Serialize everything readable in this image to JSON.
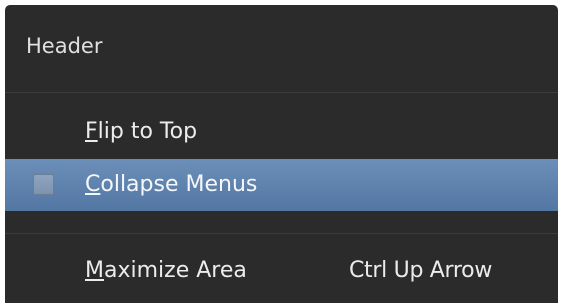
{
  "menu": {
    "title": "Header",
    "items": [
      {
        "label": "Flip to Top",
        "mnemonic": "F",
        "shortcut": ""
      },
      {
        "label": "Collapse Menus",
        "mnemonic": "C",
        "checkbox": true,
        "checked": false,
        "highlighted": true,
        "shortcut": ""
      },
      {
        "label": "Maximize Area",
        "mnemonic": "M",
        "shortcut": "Ctrl Up Arrow"
      }
    ]
  },
  "colors": {
    "menu_background": "#2b2b2b",
    "highlight": "#5f83ae",
    "text": "#e6e6e6"
  }
}
